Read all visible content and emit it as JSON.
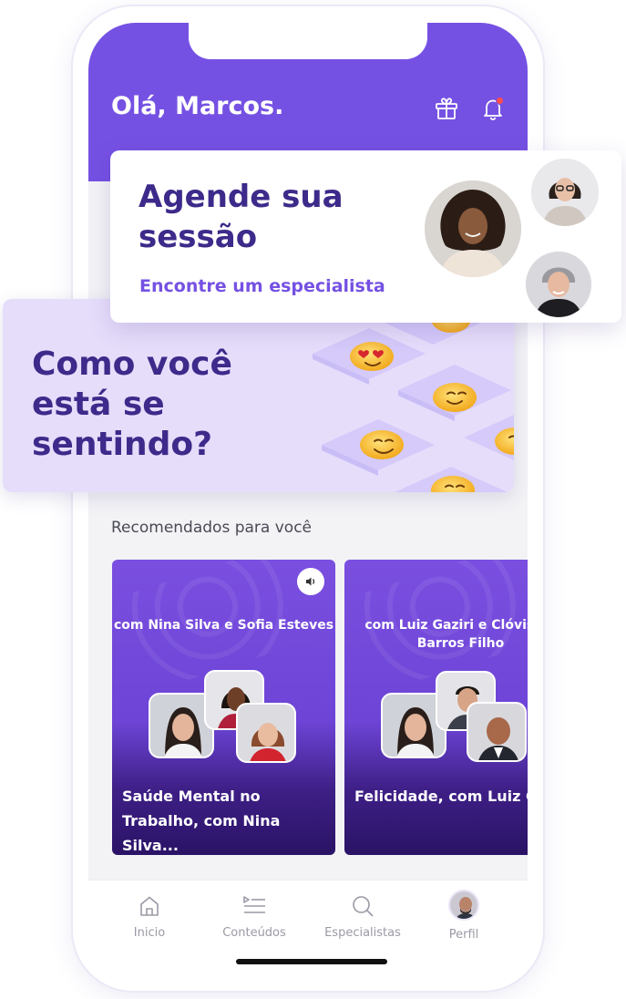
{
  "header": {
    "greeting": "Olá, Marcos."
  },
  "session_card": {
    "title": "Agende sua sessão",
    "link_label": "Encontre um especialista"
  },
  "mood_card": {
    "title": "Como você está se sentindo?"
  },
  "recommendations": {
    "section_title": "Recomendados para você",
    "cards": [
      {
        "hosts": "com Nina Silva e Sofia Esteves",
        "title": "Saúde Mental no Trabalho, com Nina Silva..."
      },
      {
        "hosts": "com Luiz Gaziri e Clóvis de Barros Filho",
        "title": "Felicidade, com Luiz Ga... e Clóvis de Barros Filho"
      }
    ]
  },
  "tabbar": {
    "items": [
      {
        "label": "Inicio",
        "icon": "home-icon"
      },
      {
        "label": "Conteúdos",
        "icon": "list-play-icon"
      },
      {
        "label": "Especialistas",
        "icon": "search-icon"
      },
      {
        "label": "Perfil",
        "icon": "avatar"
      }
    ]
  },
  "colors": {
    "brand": "#7551e3",
    "dark_purple": "#3d2a8a",
    "mood_background": "#e6ddfb",
    "notification": "#ff4d4d"
  }
}
